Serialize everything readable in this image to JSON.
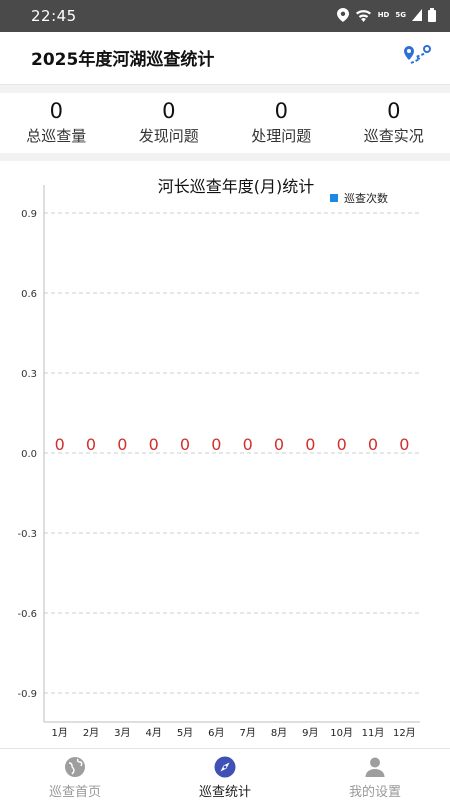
{
  "status_bar": {
    "time": "22:45",
    "network_label": "HD",
    "signal_label": "5G"
  },
  "header": {
    "title": "2025年度河湖巡查统计",
    "map_icon": "map-route-icon"
  },
  "stats": [
    {
      "value": "0",
      "label": "总巡查量"
    },
    {
      "value": "0",
      "label": "发现问题"
    },
    {
      "value": "0",
      "label": "处理问题"
    },
    {
      "value": "0",
      "label": "巡查实况"
    }
  ],
  "chart_data": {
    "type": "bar",
    "title": "河长巡查年度(月)统计",
    "categories": [
      "1月",
      "2月",
      "3月",
      "4月",
      "5月",
      "6月",
      "7月",
      "8月",
      "9月",
      "10月",
      "11月",
      "12月"
    ],
    "series": [
      {
        "name": "巡查次数",
        "values": [
          0,
          0,
          0,
          0,
          0,
          0,
          0,
          0,
          0,
          0,
          0,
          0
        ],
        "color": "#1e88e5"
      }
    ],
    "yticks": [
      "0.9",
      "0.6",
      "0.3",
      "0.0",
      "-0.3",
      "-0.6",
      "-0.9"
    ],
    "ylim": [
      -1,
      1
    ],
    "legend_position": "top-right",
    "grid": true,
    "value_label_color": "#d32f2f"
  },
  "tabbar": {
    "items": [
      {
        "label": "巡查首页",
        "icon": "globe-icon",
        "active": false
      },
      {
        "label": "巡查统计",
        "icon": "compass-icon",
        "active": true
      },
      {
        "label": "我的设置",
        "icon": "person-icon",
        "active": false
      }
    ]
  },
  "colors": {
    "accent": "#2c6fd6",
    "statusbar": "#4a4a4a",
    "active_tab": "#3f51b5"
  }
}
